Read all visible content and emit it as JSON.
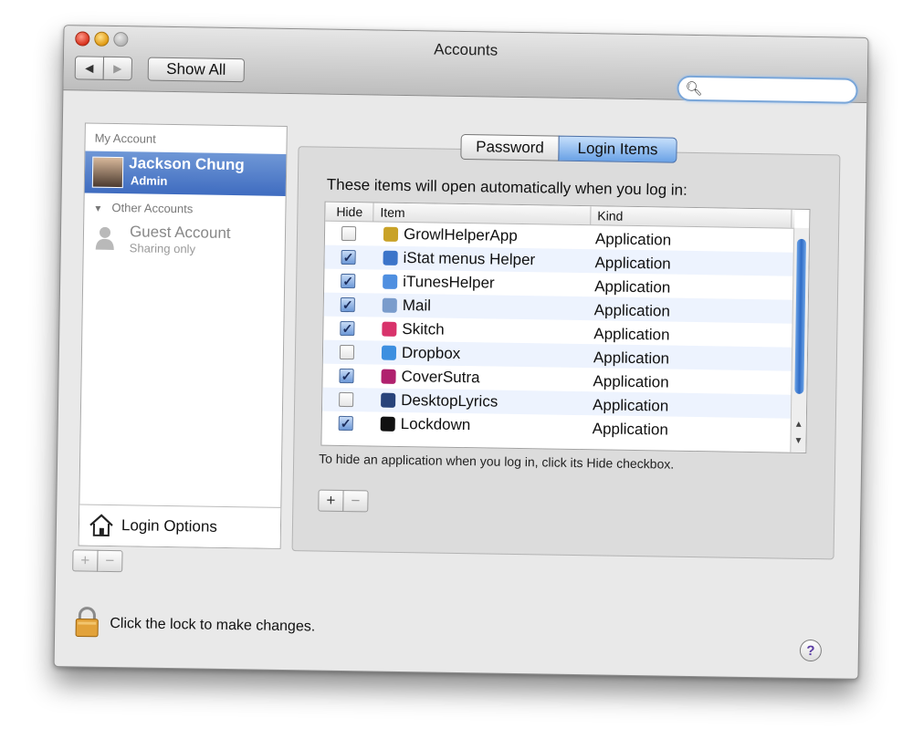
{
  "window": {
    "title": "Accounts"
  },
  "toolbar": {
    "back": "◀",
    "forward": "▶",
    "show_all": "Show All",
    "search_placeholder": ""
  },
  "sidebar": {
    "my_account_header": "My Account",
    "current_user": {
      "name": "Jackson Chung",
      "role": "Admin"
    },
    "other_accounts_header": "Other Accounts",
    "guest": {
      "name": "Guest Account",
      "role": "Sharing only"
    },
    "login_options": "Login Options",
    "add": "+",
    "remove": "−"
  },
  "tabs": {
    "password": "Password",
    "login_items": "Login Items"
  },
  "login_items": {
    "description": "These items will open automatically when you log in:",
    "columns": {
      "hide": "Hide",
      "item": "Item",
      "kind": "Kind"
    },
    "rows": [
      {
        "hide": false,
        "name": "GrowlHelperApp",
        "kind": "Application",
        "icon": "growl-icon",
        "color": "#c9a227"
      },
      {
        "hide": true,
        "name": "iStat menus Helper",
        "kind": "Application",
        "icon": "istat-icon",
        "color": "#3b74c9"
      },
      {
        "hide": true,
        "name": "iTunesHelper",
        "kind": "Application",
        "icon": "itunes-icon",
        "color": "#4f8fe0"
      },
      {
        "hide": true,
        "name": "Mail",
        "kind": "Application",
        "icon": "mail-icon",
        "color": "#7a9ccc"
      },
      {
        "hide": true,
        "name": "Skitch",
        "kind": "Application",
        "icon": "skitch-icon",
        "color": "#d8336b"
      },
      {
        "hide": false,
        "name": "Dropbox",
        "kind": "Application",
        "icon": "dropbox-icon",
        "color": "#3d8fe0"
      },
      {
        "hide": true,
        "name": "CoverSutra",
        "kind": "Application",
        "icon": "coversutra-icon",
        "color": "#b0216e"
      },
      {
        "hide": false,
        "name": "DesktopLyrics",
        "kind": "Application",
        "icon": "desktoplyrics-icon",
        "color": "#28437a"
      },
      {
        "hide": true,
        "name": "Lockdown",
        "kind": "Application",
        "icon": "lockdown-icon",
        "color": "#111111"
      }
    ],
    "hint": "To hide an application when you log in, click its Hide checkbox.",
    "add": "+",
    "remove": "−"
  },
  "footer": {
    "lock_text": "Click the lock to make changes.",
    "help": "?"
  },
  "colors": {
    "selection": "#3f6cc0",
    "accent": "#6aa2e6"
  }
}
